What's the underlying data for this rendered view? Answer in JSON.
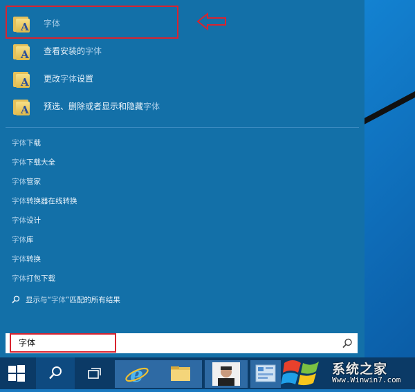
{
  "best_match": [
    {
      "label_pre": "",
      "label_hi": "字体",
      "label_post": "",
      "icon": "font-folder-icon"
    },
    {
      "label_pre": "查看安装的",
      "label_hi": "字体",
      "label_post": "",
      "icon": "font-folder-icon"
    },
    {
      "label_pre": "更改",
      "label_hi": "字体",
      "label_post": "设置",
      "icon": "font-folder-icon"
    },
    {
      "label_pre": "预选、删除或者显示和隐藏",
      "label_hi": "字体",
      "label_post": "",
      "icon": "font-folder-icon"
    }
  ],
  "suggestions": [
    {
      "hi": "字体",
      "rest": "下载"
    },
    {
      "hi": "字体",
      "rest": "下载大全"
    },
    {
      "hi": "字体",
      "rest": "管家"
    },
    {
      "hi": "字体",
      "rest": "转换器在线转换"
    },
    {
      "hi": "字体",
      "rest": "设计"
    },
    {
      "hi": "字体",
      "rest": "库"
    },
    {
      "hi": "字体",
      "rest": "转换"
    },
    {
      "hi": "字体",
      "rest": "打包下载"
    }
  ],
  "web_search": {
    "pre": "显示与“",
    "hi": "字体",
    "post": "”匹配的所有结果"
  },
  "search": {
    "value": "字体"
  },
  "watermark": {
    "title": "系统之家",
    "url": "Www.Winwin7.com"
  },
  "colors": {
    "highlight_border": "#d9232f",
    "panel": "#1370a8",
    "taskbar": "#0b3a66"
  }
}
